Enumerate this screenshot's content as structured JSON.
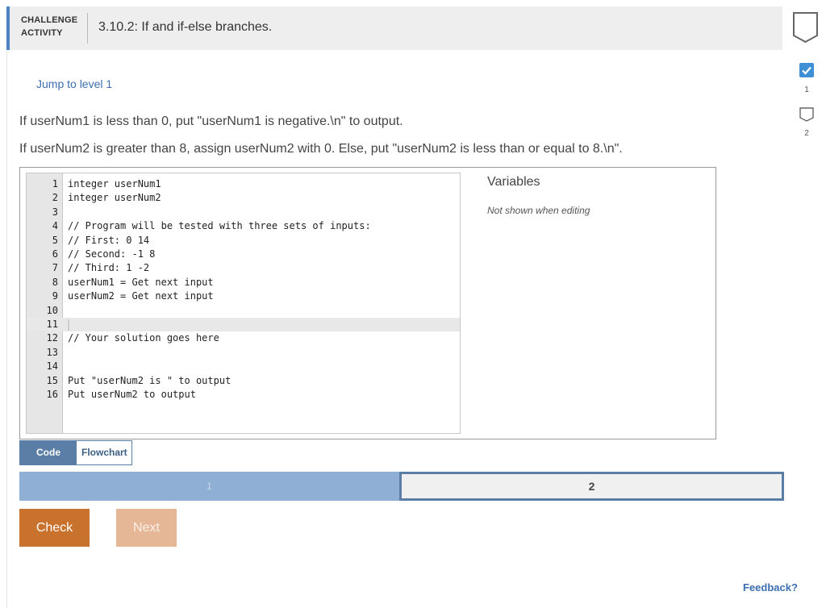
{
  "header": {
    "label_line1": "CHALLENGE",
    "label_line2": "ACTIVITY",
    "title": "3.10.2: If and if-else branches."
  },
  "completion_icon": "unchecked-shield-icon",
  "jump_link": "Jump to level 1",
  "prompts": [
    "If userNum1 is less than 0, put \"userNum1 is negative.\\n\" to output.",
    "If userNum2 is greater than 8, assign userNum2 with 0. Else, put \"userNum2 is less than or equal to 8.\\n\"."
  ],
  "levels": [
    {
      "number": "1",
      "state": "completed",
      "icon": "checkbox-checked-icon"
    },
    {
      "number": "2",
      "state": "incomplete",
      "icon": "checkbox-empty-icon"
    }
  ],
  "editor": {
    "active_line": 11,
    "lines": [
      {
        "num": "1",
        "code": "integer userNum1"
      },
      {
        "num": "2",
        "code": "integer userNum2"
      },
      {
        "num": "3",
        "code": ""
      },
      {
        "num": "4",
        "code": "// Program will be tested with three sets of inputs:"
      },
      {
        "num": "5",
        "code": "// First: 0 14"
      },
      {
        "num": "6",
        "code": "// Second: -1 8"
      },
      {
        "num": "7",
        "code": "// Third: 1 -2"
      },
      {
        "num": "8",
        "code": "userNum1 = Get next input"
      },
      {
        "num": "9",
        "code": "userNum2 = Get next input"
      },
      {
        "num": "10",
        "code": ""
      },
      {
        "num": "11",
        "code": ""
      },
      {
        "num": "12",
        "code": "// Your solution goes here"
      },
      {
        "num": "13",
        "code": ""
      },
      {
        "num": "14",
        "code": ""
      },
      {
        "num": "15",
        "code": "Put \"userNum2 is \" to output"
      },
      {
        "num": "16",
        "code": "Put userNum2 to output"
      }
    ]
  },
  "variables": {
    "title": "Variables",
    "note": "Not shown when editing"
  },
  "view_tabs": {
    "code": "Code",
    "flowchart": "Flowchart",
    "selected": "Code"
  },
  "progress": {
    "segments": [
      "1",
      "2"
    ],
    "current": "2"
  },
  "buttons": {
    "check": "Check",
    "next": "Next"
  },
  "feedback_link": "Feedback?",
  "colors": {
    "accent_blue": "#4d82c4",
    "check_orange": "#c8722d",
    "next_disabled": "#e6b797",
    "tab_selected": "#5a7ea6",
    "progress_done": "#8fb0d4",
    "link_blue": "#3b6eb0"
  }
}
